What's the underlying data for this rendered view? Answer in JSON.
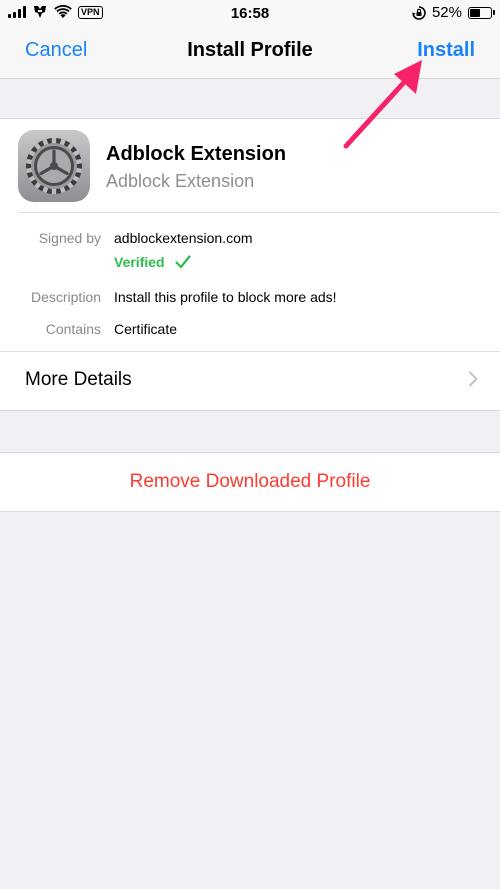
{
  "status_bar": {
    "time": "16:58",
    "vpn": "VPN",
    "battery_percent": "52%",
    "battery_level": 0.52,
    "icons": [
      "signal-icon",
      "carrier-logo-icon",
      "wifi-icon",
      "rotation-lock-icon",
      "battery-icon"
    ]
  },
  "nav": {
    "cancel_label": "Cancel",
    "title": "Install Profile",
    "install_label": "Install"
  },
  "profile": {
    "name": "Adblock Extension",
    "subtitle": "Adblock Extension",
    "icon": "settings-gear-icon",
    "signed_by_label": "Signed by",
    "signed_by_value": "adblockextension.com",
    "verified_label": "Verified",
    "description_label": "Description",
    "description_value": "Install this profile to block more ads!",
    "contains_label": "Contains",
    "contains_value": "Certificate",
    "more_details_label": "More Details"
  },
  "actions": {
    "remove_label": "Remove Downloaded Profile"
  },
  "colors": {
    "accent": "#1a82fb",
    "destructive": "#ff3b30",
    "verified": "#2dbd4e",
    "annotation_arrow": "#f7236a",
    "background": "#efeff4"
  }
}
